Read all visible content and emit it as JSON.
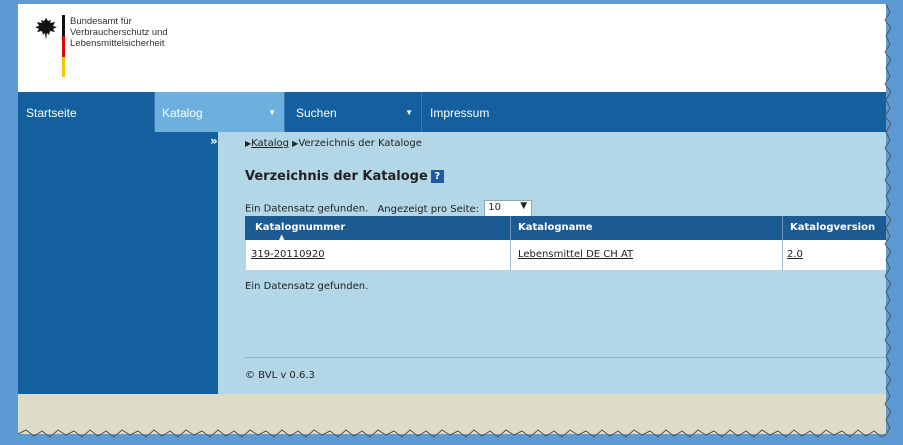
{
  "agency": {
    "line1": "Bundesamt für",
    "line2": "Verbraucherschutz und",
    "line3": "Lebensmittelsicherheit"
  },
  "nav": {
    "home": "Startseite",
    "catalog": "Katalog",
    "search": "Suchen",
    "imprint": "Impressum",
    "caret": "▼"
  },
  "sidebar": {
    "toggle": "»"
  },
  "breadcrumb": {
    "link": "Katalog",
    "current": "Verzeichnis der Kataloge",
    "arrow": "▶"
  },
  "page": {
    "title": "Verzeichnis der Kataloge",
    "help": "?",
    "found": "Ein Datensatz gefunden.",
    "per_page_label": "Angezeigt pro Seite:",
    "per_page_value": "10",
    "found_bottom": "Ein Datensatz gefunden."
  },
  "table": {
    "headers": [
      "Katalognummer",
      "Katalogname",
      "Katalogversion"
    ],
    "rows": [
      [
        "319-20110920",
        "Lebensmittel DE CH AT",
        "2.0"
      ]
    ]
  },
  "footer": {
    "version": "© BVL v 0.6.3"
  },
  "colors": {
    "nav": "#14609e",
    "nav_active": "#6db0dd",
    "content_bg": "#b3d7e6",
    "table_header": "#1c5a92",
    "bottom_bar": "#dedcc8",
    "desktop": "#5d9ad3"
  }
}
